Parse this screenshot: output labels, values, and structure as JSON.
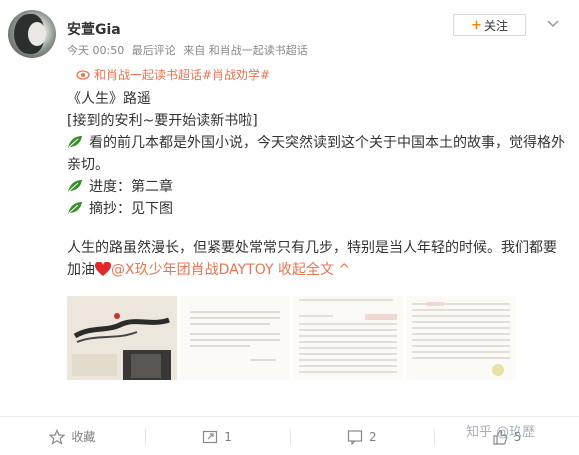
{
  "user": {
    "name": "安萱Gia"
  },
  "meta": {
    "time": "今天 00:50",
    "last_comment": "最后评论",
    "source": "来自 和肖战一起读书超话"
  },
  "follow_button": {
    "label": "关注"
  },
  "topic_tag": {
    "text": "和肖战一起读书超话#肖战劝学#"
  },
  "post": {
    "line1": "《人生》路遥",
    "line2": "[接到的安利~要开始读新书啦]",
    "line3": "看的前几本都是外国小说，今天突然读到这个关于中国本土的故事，觉得格外",
    "line4": "亲切。",
    "line5": "进度：第二章",
    "line6": "摘抄：见下图",
    "line7": "人生的路虽然漫长，但紧要处常常只有几步，特别是当人年轻的时候。我们都要",
    "line8_prefix": "加油",
    "mention": "@X玖少年团肖战DAYTOY",
    "fold": "收起全文 ^"
  },
  "images": {
    "img2_text": "人生的道路虽然漫长，但紧要处常常只有几步，特别是当人年轻的时候。",
    "img2_sign": "——柳青",
    "img3_text": "第一章 高加林今天没有心思去地里干活……",
    "img4_text": "大约一年以后，高加林在县城……"
  },
  "actions": [
    {
      "label": "收藏"
    },
    {
      "label": "1"
    },
    {
      "label": "2"
    },
    {
      "label": "5"
    }
  ],
  "watermark": {
    "text": "知乎 @玖歷"
  },
  "colors": {
    "accent": "#eb7350",
    "leaf": "#3b8f2f",
    "heart": "#e0292b"
  }
}
